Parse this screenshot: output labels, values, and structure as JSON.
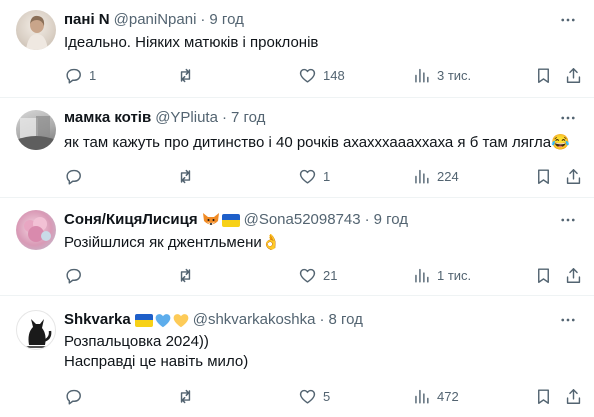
{
  "tweets": [
    {
      "name": "пані N",
      "handle": "@paniNpani",
      "time": "9 год",
      "text_lines": [
        "Ідеально. Ніяких матюків і проклонів"
      ],
      "replies": "1",
      "retweets": "",
      "likes": "148",
      "views": "3 тис.",
      "name_emoji": []
    },
    {
      "name": "мамка котів",
      "handle": "@YPliuta",
      "time": "7 год",
      "text_lines": [
        "як там кажуть про дитинство і 40 рочків ахахххаааххаха я б там лягла😂"
      ],
      "replies": "",
      "retweets": "",
      "likes": "1",
      "views": "224",
      "name_emoji": []
    },
    {
      "name": "Соня/КицяЛисиця",
      "handle": "@Sona52098743",
      "time": "9 год",
      "text_lines": [
        "Розійшлися як джентльмени👌"
      ],
      "replies": "",
      "retweets": "",
      "likes": "21",
      "views": "1 тис.",
      "name_emoji": [
        "fox-icon",
        "ukraine-flag-icon"
      ]
    },
    {
      "name": "Shkvarka",
      "handle": "@shkvarkakoshka",
      "time": "8 год",
      "text_lines": [
        "Розпальцовка 2024))",
        "Насправді це навіть мило)"
      ],
      "replies": "",
      "retweets": "",
      "likes": "5",
      "views": "472",
      "name_emoji": [
        "ukraine-flag-icon",
        "blue-heart-icon",
        "yellow-heart-icon"
      ]
    }
  ],
  "dot": "·",
  "colors": {
    "text": "#0f1419",
    "secondary": "#536471",
    "divider": "#eff3f4"
  }
}
